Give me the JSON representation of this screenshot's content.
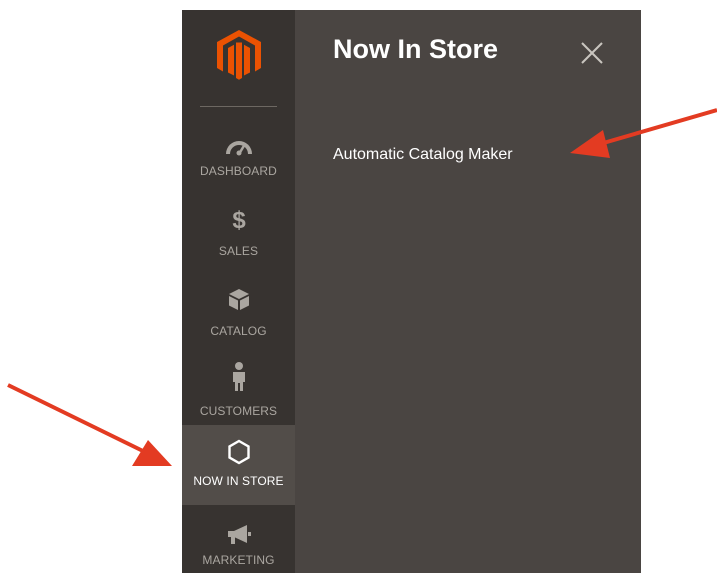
{
  "sidebar": {
    "logo_icon": "magento-logo-icon",
    "items": [
      {
        "label": "DASHBOARD",
        "icon": "speedometer-icon",
        "active": false
      },
      {
        "label": "SALES",
        "icon": "dollar-icon",
        "active": false
      },
      {
        "label": "CATALOG",
        "icon": "box-icon",
        "active": false
      },
      {
        "label": "CUSTOMERS",
        "icon": "person-icon",
        "active": false
      },
      {
        "label": "NOW IN STORE",
        "icon": "hexagon-icon",
        "active": true
      },
      {
        "label": "MARKETING",
        "icon": "megaphone-icon",
        "active": false
      }
    ]
  },
  "panel": {
    "title": "Now In Store",
    "close_icon": "close-icon",
    "links": [
      "Automatic Catalog Maker"
    ]
  },
  "colors": {
    "brand": "#eb5202",
    "sidebar_bg": "#373330",
    "sidebar_active_bg": "#524d49",
    "panel_bg": "#4a4542",
    "annotation_arrow": "#e33b22"
  }
}
